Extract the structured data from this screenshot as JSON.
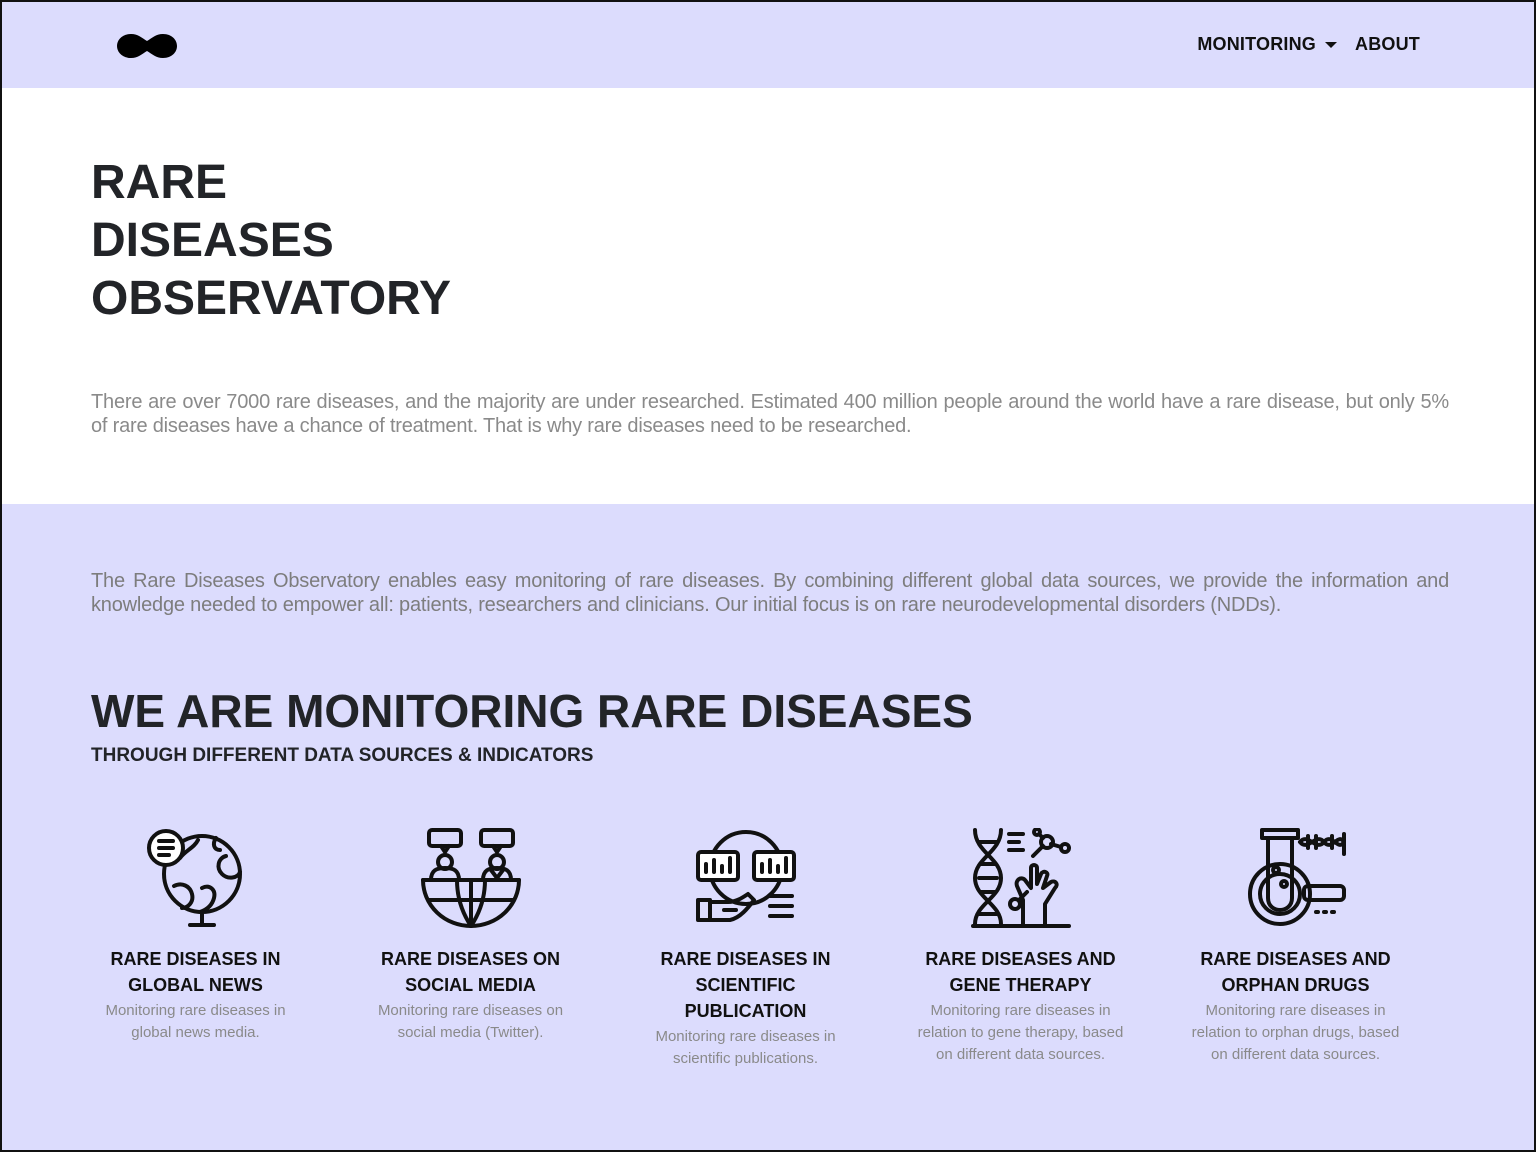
{
  "navbar": {
    "logo_icon": "infinity-blob-logo",
    "items": [
      {
        "label": "MONITORING",
        "has_dropdown": true
      },
      {
        "label": "ABOUT",
        "has_dropdown": false
      }
    ]
  },
  "hero": {
    "title_lines": [
      "RARE",
      "DISEASES",
      "OBSERVATORY"
    ],
    "text": "There are over 7000 rare diseases, and the majority are under researched. Estimated 400 million people around the world have a rare disease, but only 5% of rare diseases have a chance of treatment. That is why rare diseases need to be researched."
  },
  "main": {
    "intro": "The Rare Diseases Observatory enables easy monitoring of rare diseases. By combining different global data sources, we provide the information and knowledge needed to empower all: patients, researchers and clinicians. Our initial focus is on rare neurodevelopmental disorders (NDDs).",
    "title": "WE ARE MONITORING RARE DISEASES",
    "subtitle": "THROUGH DIFFERENT DATA SOURCES & INDICATORS",
    "cards": [
      {
        "icon": "globe-news-icon",
        "title_1": "RARE DISEASES IN",
        "title_2": "GLOBAL NEWS",
        "desc": "Monitoring rare diseases in global news media."
      },
      {
        "icon": "social-media-icon",
        "title_1": "RARE DISEASES ON",
        "title_2": "SOCIAL MEDIA",
        "desc": "Monitoring rare diseases on social media (Twitter)."
      },
      {
        "icon": "publication-search-icon",
        "title_1": "RARE DISEASES IN",
        "title_2": "SCIENTIFIC PUBLICATION",
        "desc": "Monitoring rare diseases in scientific publications."
      },
      {
        "icon": "dna-gene-therapy-icon",
        "title_1": "RARE DISEASES AND",
        "title_2": "GENE THERAPY",
        "desc": "Monitoring rare diseases in relation to gene therapy, based on different data sources."
      },
      {
        "icon": "orphan-drug-test-tube-icon",
        "title_1": "RARE DISEASES AND",
        "title_2": "ORPHAN DRUGS",
        "desc": "Monitoring rare diseases in relation to orphan drugs, based on different data sources."
      }
    ]
  },
  "colors": {
    "accent_background": "#dcdcfd",
    "text_dark": "#222428",
    "text_muted": "#8a8a8a"
  }
}
